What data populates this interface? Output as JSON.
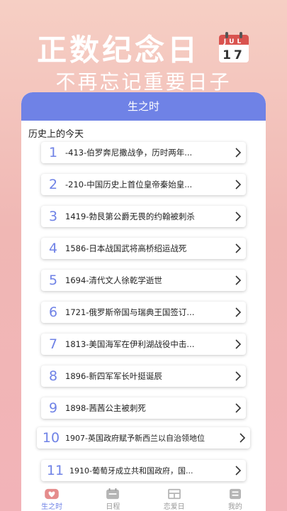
{
  "hero": {
    "title": "正数纪念日",
    "subtitle": "不再忘记重要日子",
    "calendar_month": "JUL",
    "calendar_day": "17"
  },
  "header": {
    "title": "生之时"
  },
  "section": {
    "label": "历史上的今天"
  },
  "items": [
    {
      "num": "1",
      "text": "-413-伯罗奔尼撒战争，历时两年..."
    },
    {
      "num": "2",
      "text": "-210-中国历史上首位皇帝秦始皇..."
    },
    {
      "num": "3",
      "text": "1419-勃艮第公爵无畏的约翰被刺杀"
    },
    {
      "num": "4",
      "text": "1586-日本战国武将高桥绍运战死"
    },
    {
      "num": "5",
      "text": "1694-清代文人徐乾学逝世"
    },
    {
      "num": "6",
      "text": "1721-俄罗斯帝国与瑞典王国签订..."
    },
    {
      "num": "7",
      "text": "1813-美国海军在伊利湖战役中击..."
    },
    {
      "num": "8",
      "text": "1896-新四军军长叶挺诞辰"
    },
    {
      "num": "9",
      "text": "1898-茜茜公主被刺死"
    },
    {
      "num": "10",
      "text": "1907-英国政府赋予新西兰以自治领地位"
    },
    {
      "num": "11",
      "text": "1910-葡萄牙成立共和国政府，国..."
    }
  ],
  "tabs": [
    {
      "label": "生之时",
      "icon": "heart-icon",
      "active": true
    },
    {
      "label": "日程",
      "icon": "calendar-icon",
      "active": false
    },
    {
      "label": "恋爱日",
      "icon": "layout-icon",
      "active": false
    },
    {
      "label": "我的",
      "icon": "profile-icon",
      "active": false
    }
  ],
  "colors": {
    "accent": "#6f82e6",
    "heart": "#d9534f"
  }
}
